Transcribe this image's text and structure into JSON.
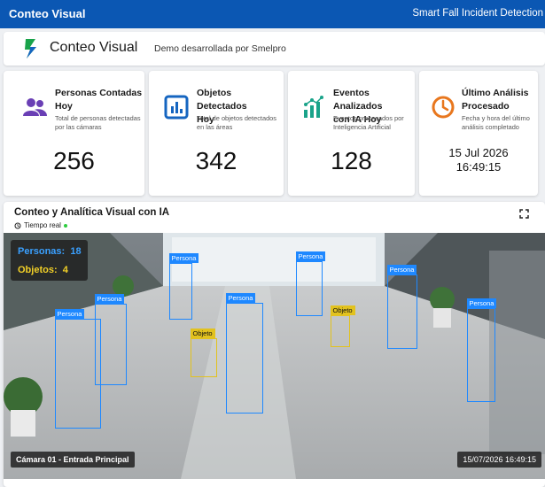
{
  "topbar": {
    "title": "Conteo Visual",
    "right_title": "Smart Fall Incident Detection"
  },
  "header": {
    "title": "Conteo Visual",
    "subtitle": "Demo desarrollada por Smelpro"
  },
  "cards": [
    {
      "title_line1": "Personas Contadas",
      "title_line2": "Hoy",
      "desc_line1": "Total de personas detectadas",
      "desc_line2": "por las cámaras",
      "value": "256",
      "icon": "people-icon",
      "color": "#6a3fb5"
    },
    {
      "title_line1": "Objetos Detectados",
      "title_line2": "Hoy",
      "desc_line1": "Total de objetos detectados",
      "desc_line2": "en las áreas",
      "value": "342",
      "icon": "bar-chart-icon",
      "color": "#1565c0"
    },
    {
      "title_line1": "Eventos Analizados",
      "title_line2": "con IA Hoy",
      "desc_line1": "Eventos procesados por",
      "desc_line2": "Inteligencia Artificial",
      "value": "128",
      "icon": "analytics-icon",
      "color": "#1aa38a"
    },
    {
      "title_line1": "Último Análisis",
      "title_line2": "Procesado",
      "desc_line1": "Fecha y hora del último",
      "desc_line2": "análisis completado",
      "date": "15 Jul 2026",
      "time": "16:49:15",
      "icon": "clock-icon",
      "color": "#e8771e"
    }
  ],
  "panel": {
    "title": "Conteo y Analítica Visual con IA",
    "live_label": "Tiempo real",
    "counter": {
      "persons_label": "Personas:",
      "persons_value": "18",
      "objects_label": "Objetos:",
      "objects_value": "4"
    },
    "detections": {
      "person_label": "Persona",
      "object_label": "Objeto"
    },
    "camera_name": "Cámara 01 - Entrada Principal",
    "timestamp": "15/07/2026  16:49:15"
  },
  "colors": {
    "brand": "#0b57b3",
    "person_box": "#1e88ff",
    "object_box": "#e2c21e",
    "live": "#2ecc40"
  }
}
